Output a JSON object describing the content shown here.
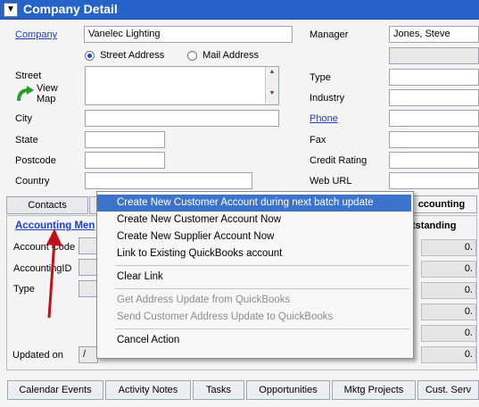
{
  "window": {
    "title": "Company Detail"
  },
  "company": {
    "label": "Company",
    "value": "Vanelec Lighting"
  },
  "manager": {
    "label": "Manager",
    "value": "Jones, Steve"
  },
  "address_type": {
    "street_label": "Street Address",
    "mail_label": "Mail Address",
    "selected": "street"
  },
  "fields": {
    "street": "Street",
    "view_map": "View\nMap",
    "city": "City",
    "state": "State",
    "postcode": "Postcode",
    "country": "Country",
    "type": "Type",
    "industry": "Industry",
    "phone": "Phone",
    "fax": "Fax",
    "credit_rating": "Credit Rating",
    "web_url": "Web URL"
  },
  "tabs": {
    "contacts": "Contacts",
    "accounting": "ccounting"
  },
  "accounting": {
    "link_label": "Accounting Men",
    "account_code": "Account Code",
    "accounting_id": "AccountingID",
    "type": "Type",
    "outstanding": "tstanding",
    "updated_on": "Updated on",
    "date_value": "/",
    "values": [
      "0.",
      "0.",
      "0.",
      "0.",
      "0.",
      "0."
    ]
  },
  "context_menu": {
    "items": [
      {
        "label": "Create New Customer Account during next batch update",
        "state": "highlighted"
      },
      {
        "label": "Create New Customer Account Now",
        "state": "normal"
      },
      {
        "label": "Create New Supplier Account Now",
        "state": "normal"
      },
      {
        "label": "Link to Existing QuickBooks account",
        "state": "normal"
      },
      {
        "label": "Clear Link",
        "state": "normal"
      },
      {
        "label": "Get Address Update from QuickBooks",
        "state": "disabled"
      },
      {
        "label": "Send Customer Address Update to QuickBooks",
        "state": "disabled"
      },
      {
        "label": "Cancel Action",
        "state": "normal"
      }
    ]
  },
  "bottom_tabs": [
    "Calendar Events",
    "Activity Notes",
    "Tasks",
    "Opportunities",
    "Mktg Projects",
    "Cust. Serv"
  ],
  "colors": {
    "title_bar": "#2563c8",
    "menu_highlight": "#3c74cc",
    "arrow": "#c0111a",
    "link": "#1a3fcf"
  }
}
